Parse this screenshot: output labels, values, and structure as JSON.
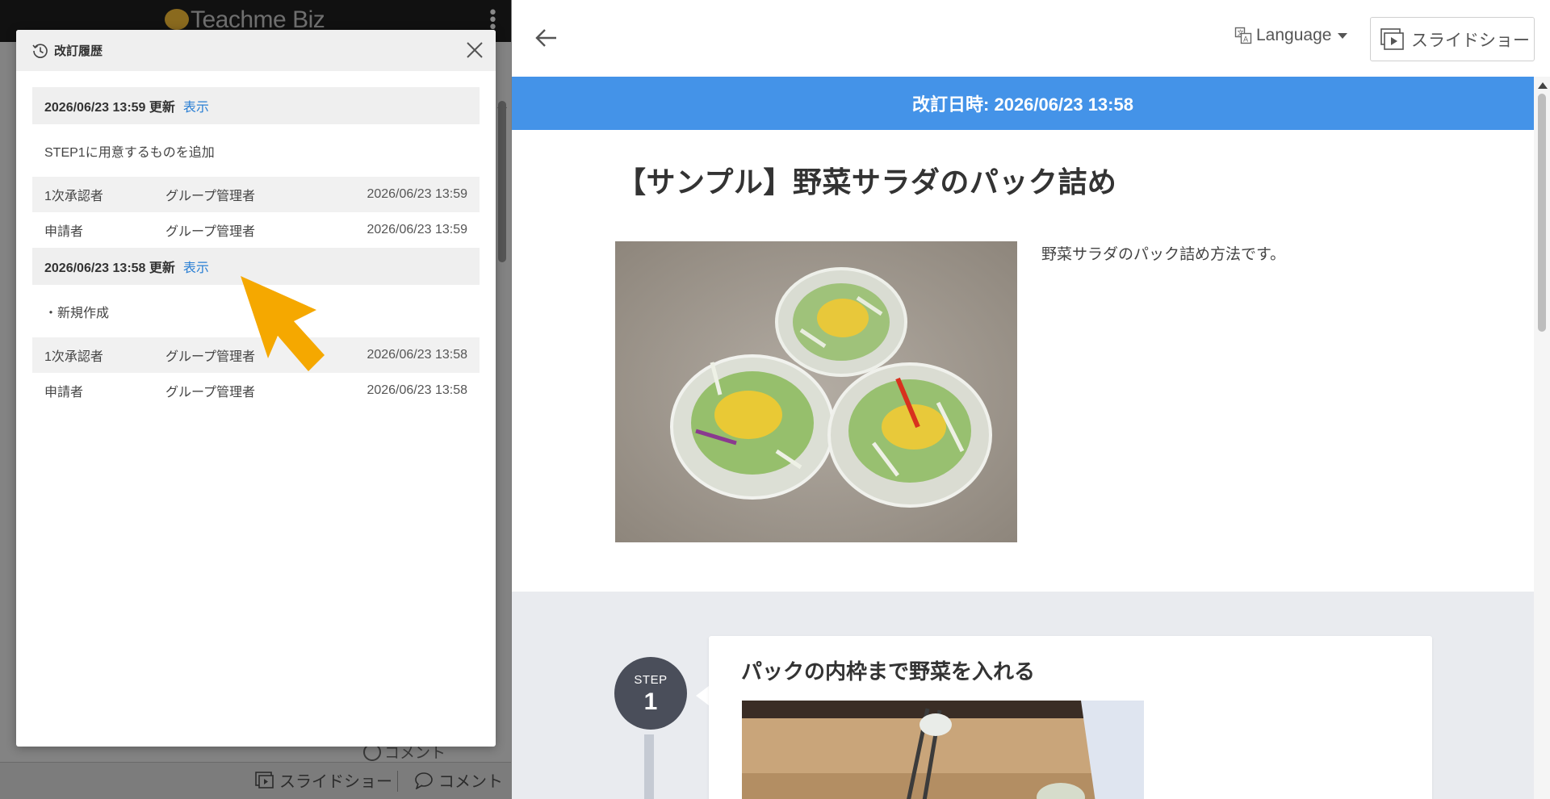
{
  "left_app": {
    "logo_text": "Teachme Biz",
    "bottom_bar": {
      "slideshow_label": "スライドショー",
      "comment_label": "コメント"
    },
    "ghost_comment_label": "コメント"
  },
  "history_modal": {
    "title": "改訂履歴",
    "icon": "history-icon",
    "close_icon": "close-icon",
    "revisions": [
      {
        "date": "2026/06/23 13:59 更新",
        "view_label": "表示",
        "note": "STEP1に用意するものを追加",
        "approvals": [
          {
            "role": "1次承認者",
            "user": "グループ管理者",
            "time": "2026/06/23 13:59"
          },
          {
            "role": "申請者",
            "user": "グループ管理者",
            "time": "2026/06/23 13:59"
          }
        ]
      },
      {
        "date": "2026/06/23 13:58 更新",
        "view_label": "表示",
        "note": "・新規作成",
        "approvals": [
          {
            "role": "1次承認者",
            "user": "グループ管理者",
            "time": "2026/06/23 13:58"
          },
          {
            "role": "申請者",
            "user": "グループ管理者",
            "time": "2026/06/23 13:58"
          }
        ]
      }
    ],
    "annotation_arrow_color": "#f5a800"
  },
  "main": {
    "back_icon": "arrow-left-icon",
    "language_label": "Language",
    "language_icon": "translate-icon",
    "slideshow_label": "スライドショー",
    "slideshow_icon": "slideshow-icon",
    "revision_banner": "改訂日時: 2026/06/23 13:58",
    "revision_banner_color": "#4493e8",
    "manual_title": "【サンプル】野菜サラダのパック詰め",
    "manual_description": "野菜サラダのパック詰め方法です。",
    "steps": [
      {
        "word": "STEP",
        "number": "1",
        "title": "パックの内枠まで野菜を入れる"
      }
    ]
  }
}
